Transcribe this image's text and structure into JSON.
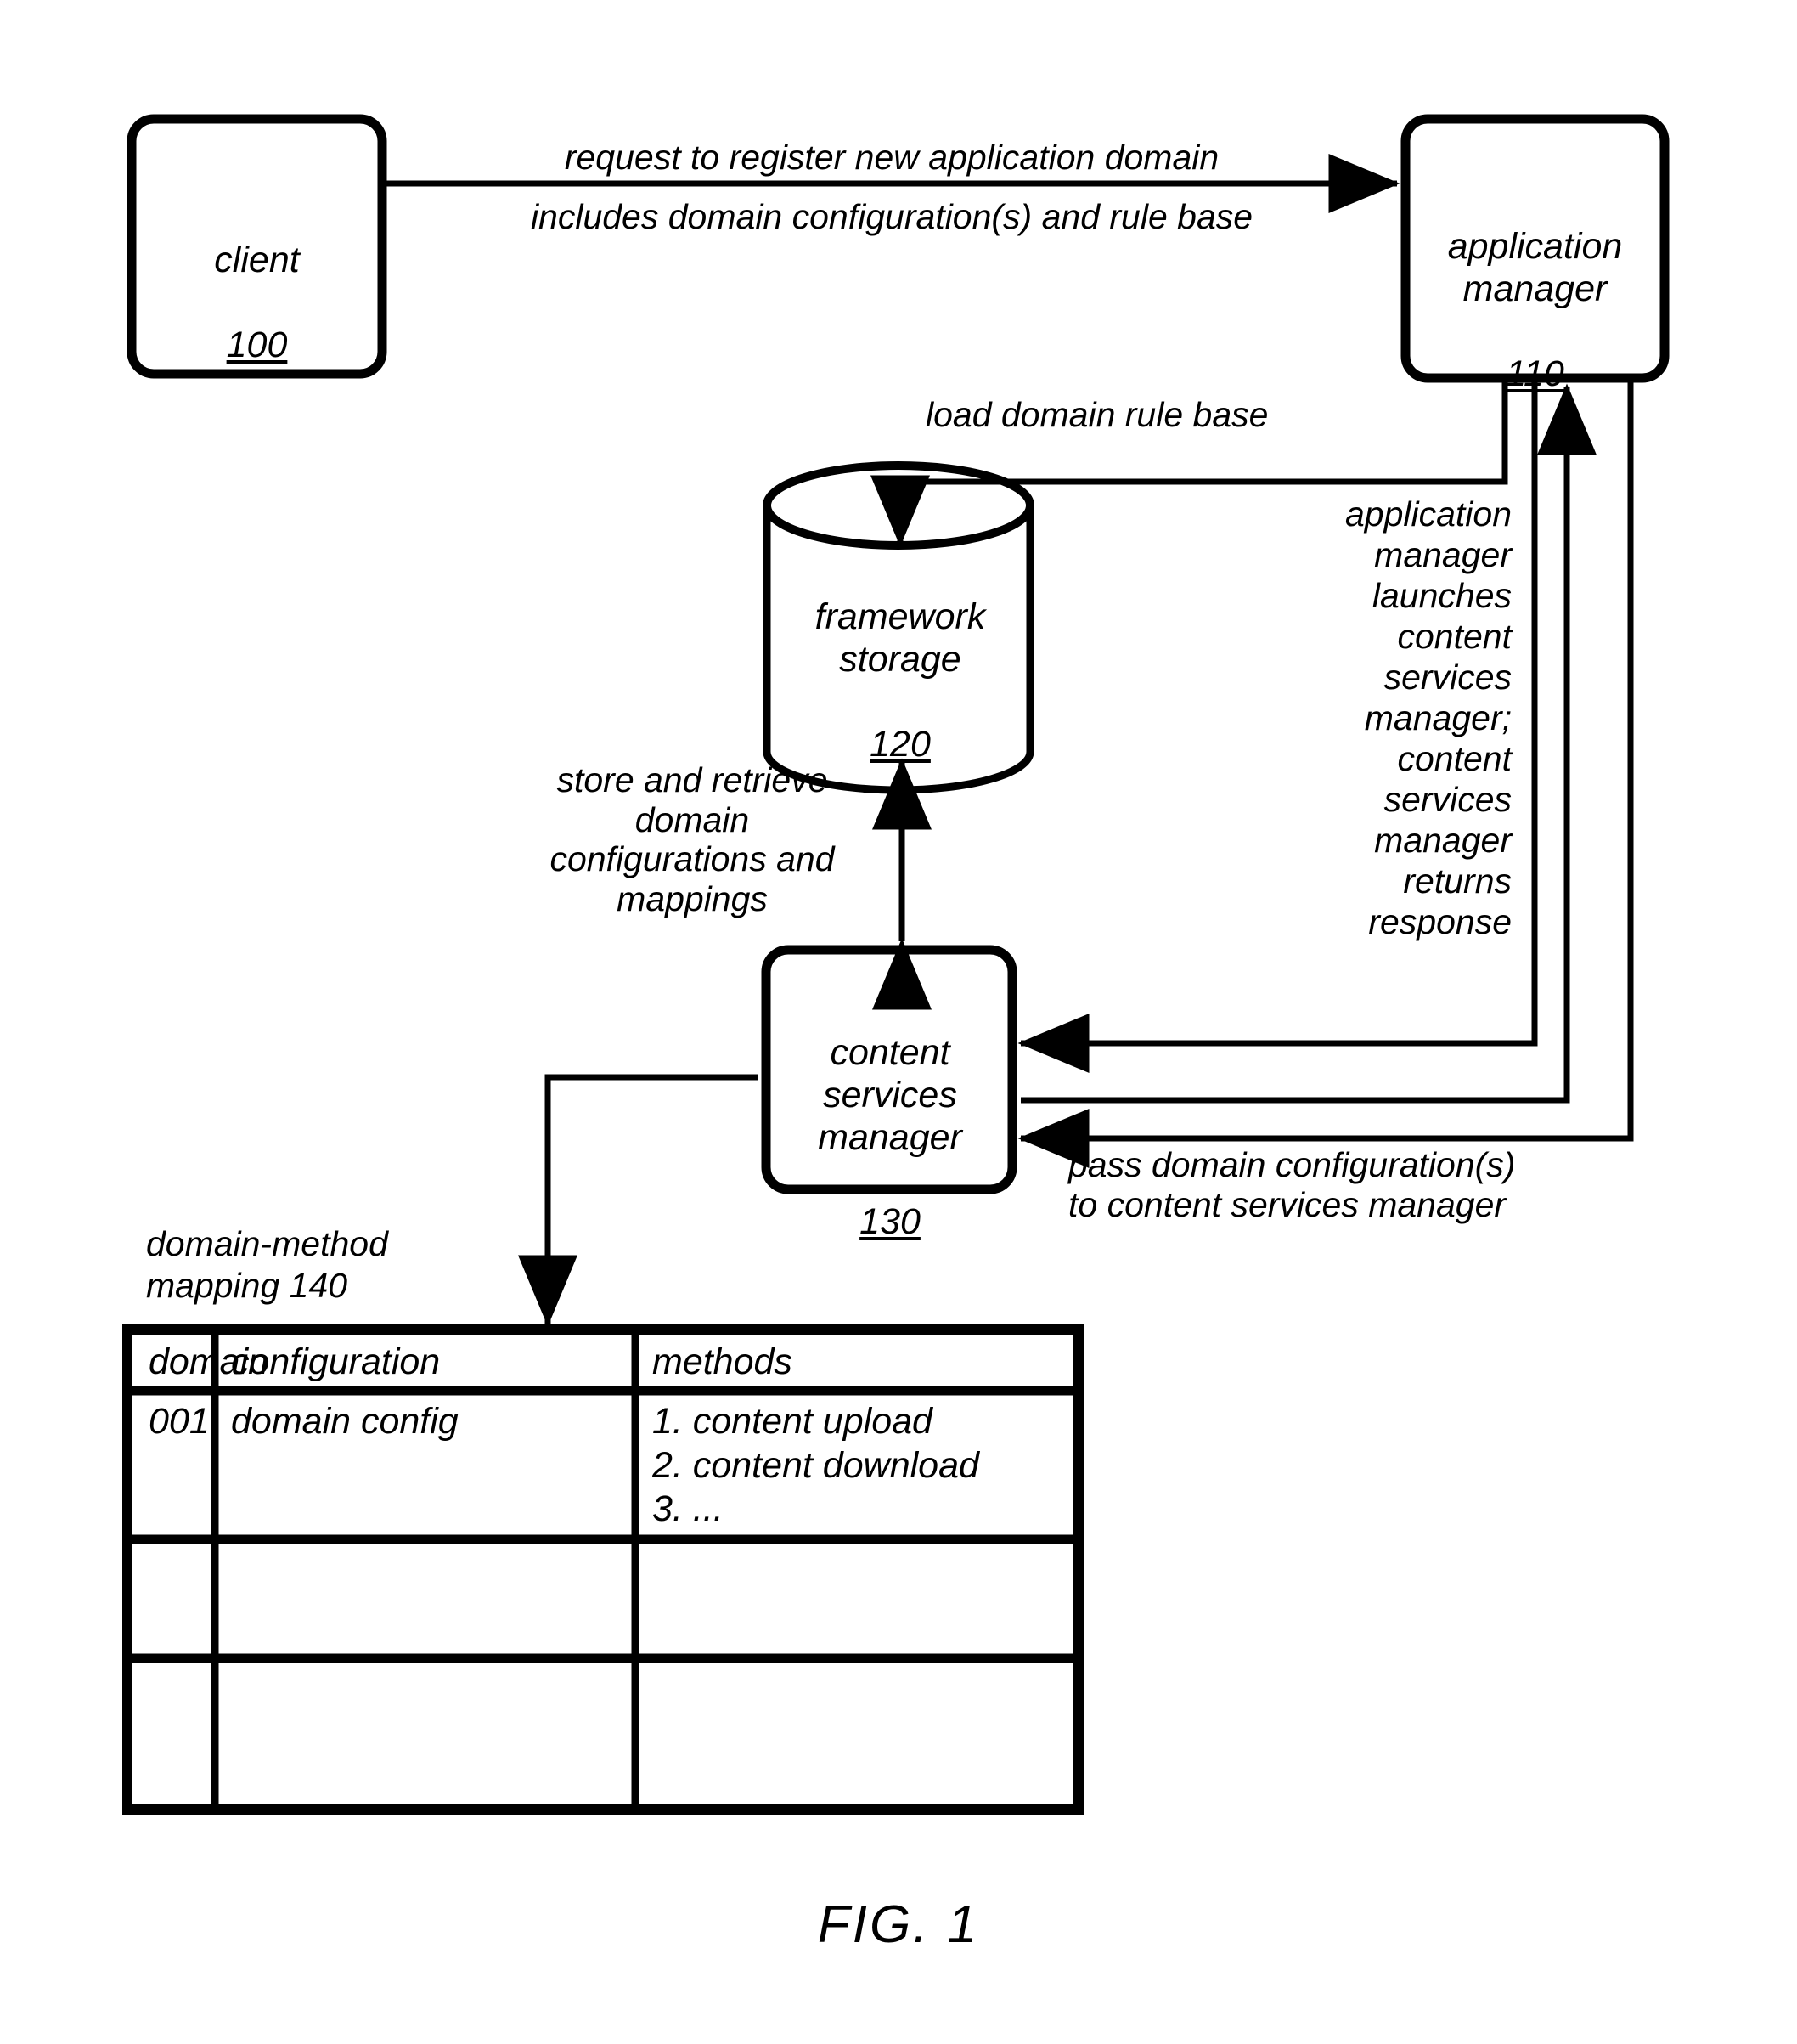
{
  "figure": {
    "caption": "FIG. 1",
    "nodes": {
      "client": {
        "title": "client",
        "ref": "100"
      },
      "app_mgr": {
        "title": "application\nmanager",
        "ref": "110"
      },
      "storage": {
        "title": "framework\nstorage",
        "ref": "120"
      },
      "csm": {
        "title": "content\nservices\nmanager",
        "ref": "130"
      }
    },
    "edges": {
      "request_line1": "request to register new application domain",
      "request_line2": "includes domain configuration(s) and rule base",
      "load_rule_base": "load domain rule base",
      "store_retrieve": "store and retrieve\ndomain\nconfigurations and\nmappings",
      "launch_return": "application\nmanager\nlaunches\ncontent\nservices\nmanager;\ncontent\nservices\nmanager\nreturns\nresponse",
      "pass_config": "pass domain configuration(s)\nto content services manager"
    },
    "table": {
      "caption": "domain-method\nmapping 140",
      "columns": [
        "domain",
        "configuration",
        "methods"
      ],
      "rows": [
        {
          "domain": "001",
          "configuration": "domain config",
          "methods": "1. content upload\n2. content download\n3. ..."
        },
        {
          "domain": "",
          "configuration": "",
          "methods": ""
        },
        {
          "domain": "",
          "configuration": "",
          "methods": ""
        }
      ]
    },
    "colors": {
      "ink": "#000000",
      "paper": "#ffffff"
    }
  }
}
